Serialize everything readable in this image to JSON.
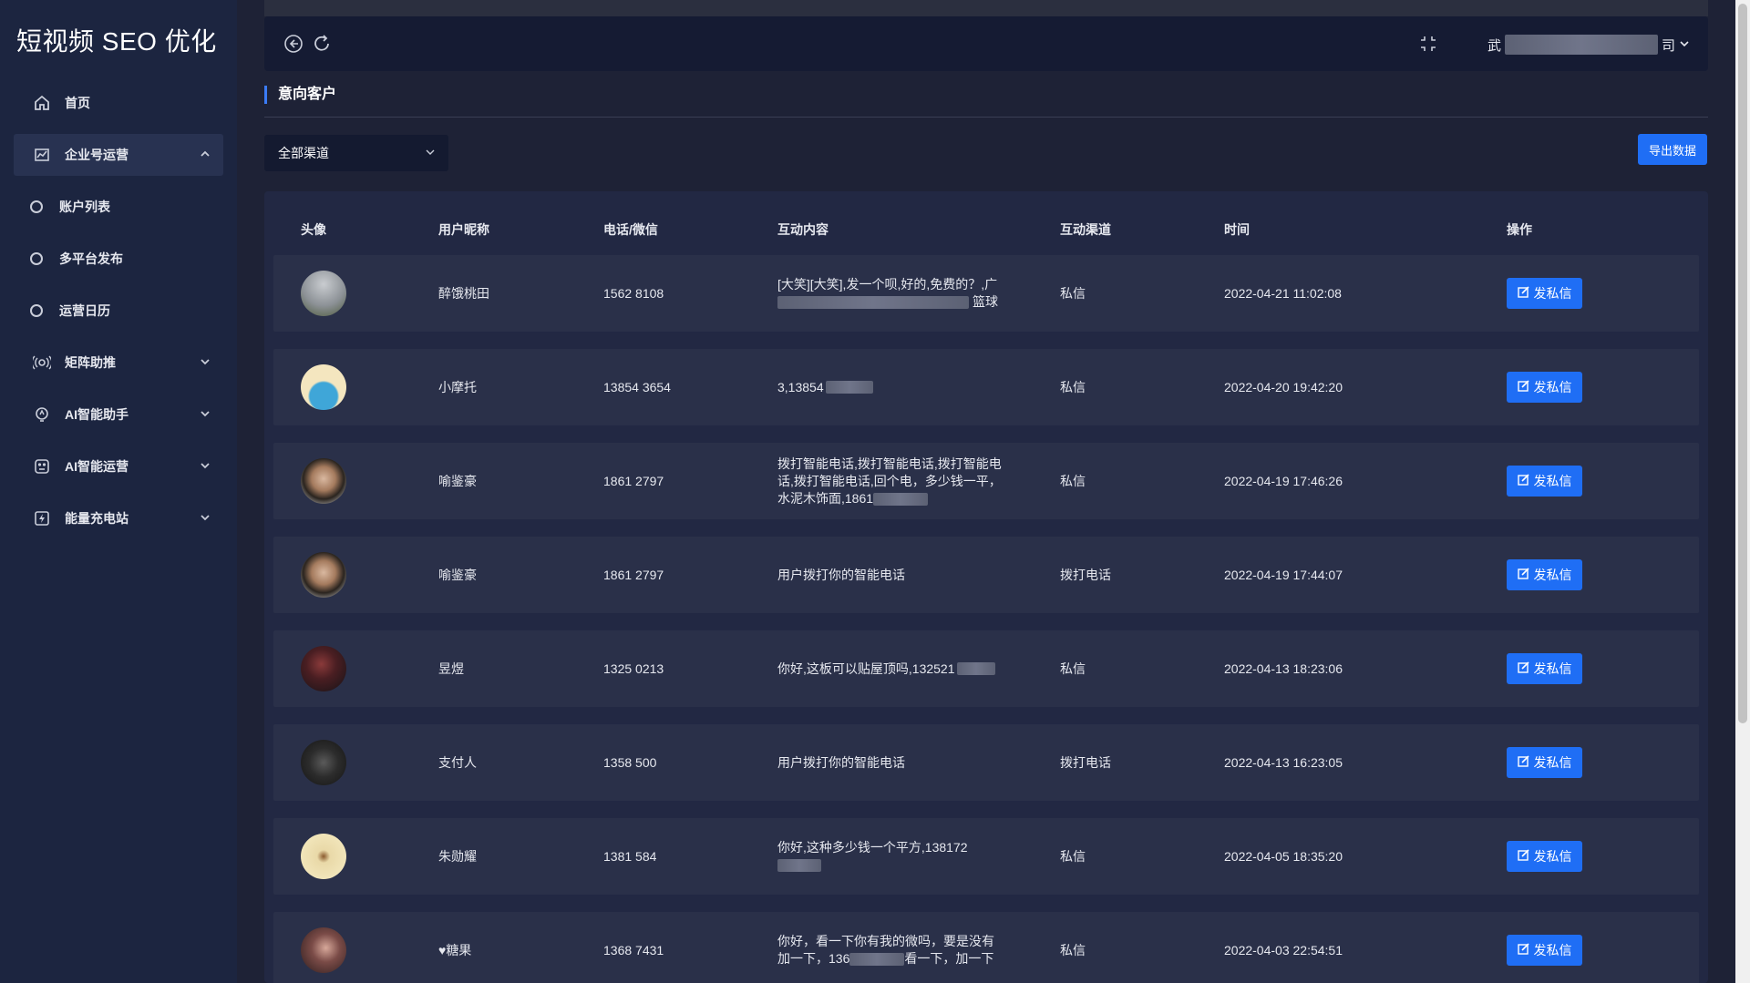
{
  "app": {
    "logo": "短视频 SEO 优化"
  },
  "sidebar": {
    "items": [
      {
        "label": "首页",
        "icon": "home-icon"
      },
      {
        "label": "企业号运营",
        "icon": "chart-icon"
      },
      {
        "label": "账户列表",
        "icon": "circle-icon"
      },
      {
        "label": "多平台发布",
        "icon": "circle-icon"
      },
      {
        "label": "运营日历",
        "icon": "circle-icon"
      },
      {
        "label": "矩阵助推",
        "icon": "broadcast-icon"
      },
      {
        "label": "AI智能助手",
        "icon": "ai-assistant-icon"
      },
      {
        "label": "AI智能运营",
        "icon": "ai-ops-icon"
      },
      {
        "label": "能量充电站",
        "icon": "energy-icon"
      }
    ]
  },
  "topbar": {
    "user_prefix": "武",
    "user_suffix": "司"
  },
  "page": {
    "title": "意向客户"
  },
  "filter": {
    "channel_value": "全部渠道"
  },
  "export_label": "导出数据",
  "table": {
    "headers": [
      "头像",
      "用户昵称",
      "电话/微信",
      "互动内容",
      "互动渠道",
      "时间",
      "操作"
    ],
    "rows": [
      {
        "nickname": "醉饿桃田",
        "phone": "1562   8108",
        "content": "[大笑][大笑],发一个呗,好的,免费的？,广",
        "content2": "篮球",
        "channel": "私信",
        "time": "2022-04-21 11:02:08",
        "action": "发私信"
      },
      {
        "nickname": "小摩托",
        "phone": "13854   3654",
        "content": "3,13854",
        "content2": "",
        "channel": "私信",
        "time": "2022-04-20 19:42:20",
        "action": "发私信"
      },
      {
        "nickname": "喻鉴豪",
        "phone": "1861   2797",
        "content": "拨打智能电话,拨打智能电话,拨打智能电话,拨打智能电话,回个电，多少钱一平，水泥木饰面,1861",
        "content2": "",
        "channel": "私信",
        "time": "2022-04-19 17:46:26",
        "action": "发私信"
      },
      {
        "nickname": "喻鉴豪",
        "phone": "1861   2797",
        "content": "用户拨打你的智能电话",
        "content2": "",
        "channel": "拨打电话",
        "time": "2022-04-19 17:44:07",
        "action": "发私信"
      },
      {
        "nickname": "昱煜",
        "phone": "1325   0213",
        "content": "你好,这板可以贴屋顶吗,132521",
        "content2": "",
        "channel": "私信",
        "time": "2022-04-13 18:23:06",
        "action": "发私信"
      },
      {
        "nickname": "支付人",
        "phone": "1358   500",
        "content": "用户拨打你的智能电话",
        "content2": "",
        "channel": "拨打电话",
        "time": "2022-04-13 16:23:05",
        "action": "发私信"
      },
      {
        "nickname": "朱勋耀",
        "phone": "1381   584",
        "content": "你好,这种多少钱一个平方,138172",
        "content2": "",
        "channel": "私信",
        "time": "2022-04-05 18:35:20",
        "action": "发私信"
      },
      {
        "nickname": "♥糖果",
        "phone": "1368   7431",
        "content": "你好，看一下你有我的微吗，要是没有加一下，136",
        "content2": "看一下，加一下",
        "channel": "私信",
        "time": "2022-04-03 22:54:51",
        "action": "发私信"
      }
    ]
  },
  "colors": {
    "accent": "#1f6ef5",
    "sidebar_bg": "#1c2540",
    "page_bg": "#1e2236"
  }
}
